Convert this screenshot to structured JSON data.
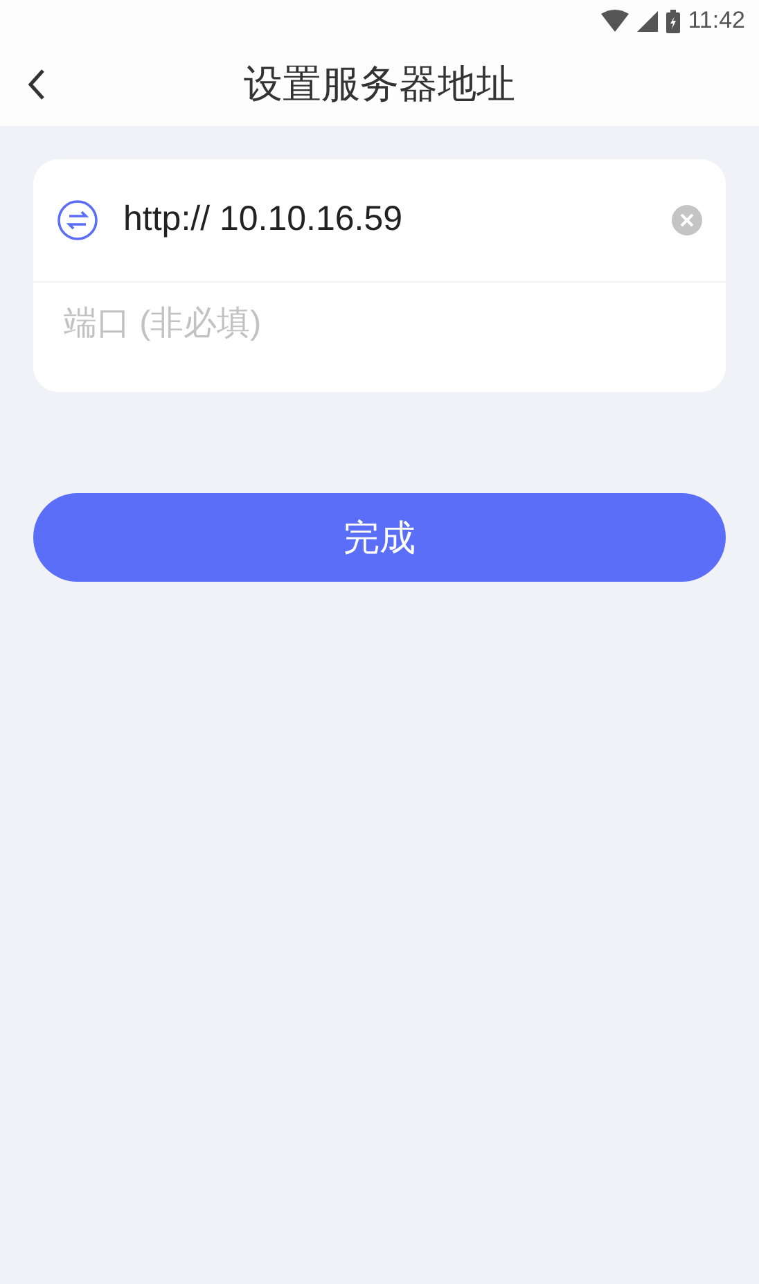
{
  "status_bar": {
    "time": "11:42"
  },
  "header": {
    "title": "设置服务器地址"
  },
  "form": {
    "server": {
      "value": "http:// 10.10.16.59"
    },
    "port": {
      "placeholder": "端口 (非必填)"
    }
  },
  "submit_button": {
    "label": "完成"
  }
}
